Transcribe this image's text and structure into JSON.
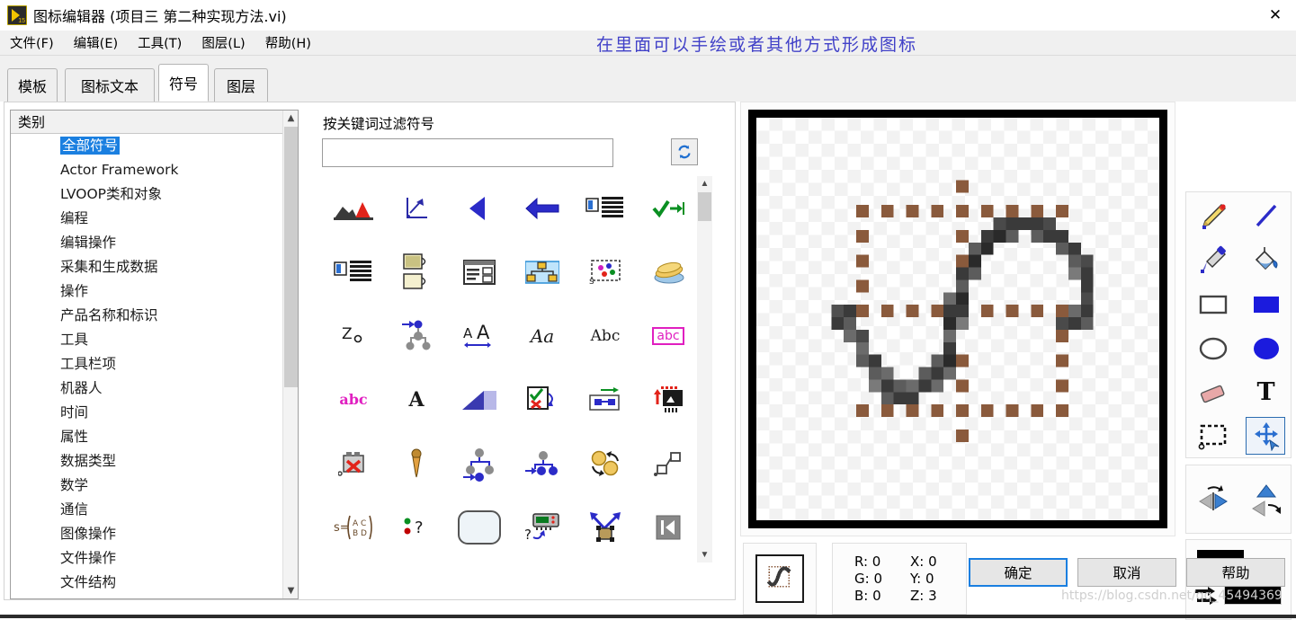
{
  "window": {
    "title": "图标编辑器 (项目三  第二种实现方法.vi)",
    "app_icon": "labview-vi-icon",
    "app_icon_version": "15",
    "close_label": "✕"
  },
  "menubar": {
    "items": [
      {
        "label": "文件(F)",
        "name": "menu-file"
      },
      {
        "label": "编辑(E)",
        "name": "menu-edit"
      },
      {
        "label": "工具(T)",
        "name": "menu-tools"
      },
      {
        "label": "图层(L)",
        "name": "menu-layers"
      },
      {
        "label": "帮助(H)",
        "name": "menu-help"
      }
    ]
  },
  "annotation": {
    "text": "在里面可以手绘或者其他方式形成图标",
    "color": "#4141c8"
  },
  "tabs": {
    "items": [
      {
        "label": "模板",
        "selected": false
      },
      {
        "label": "图标文本",
        "selected": false
      },
      {
        "label": "符号",
        "selected": true
      },
      {
        "label": "图层",
        "selected": false
      }
    ]
  },
  "category_panel": {
    "header": "类别",
    "selected": "全部符号",
    "items": [
      "全部符号",
      "Actor Framework",
      "LVOOP类和对象",
      "编程",
      "编辑操作",
      "采集和生成数据",
      "操作",
      "产品名称和标识",
      "工具",
      "工具栏项",
      "机器人",
      "时间",
      "属性",
      "数据类型",
      "数学",
      "通信",
      "图像操作",
      "文件操作",
      "文件结构"
    ]
  },
  "filter": {
    "label": "按关键词过滤符号",
    "value": "",
    "placeholder": "",
    "refresh_icon": "refresh-icon"
  },
  "symbol_grid": {
    "rows": [
      [
        "mountain-graph-icon",
        "axes-arrow-icon",
        "triangle-left-icon",
        "arrow-left-icon",
        "doc-lines-icon",
        "check-tab-icon"
      ],
      [
        "doc-lines-icon",
        "two-cups-icon",
        "table-form-icon",
        "hierarchy-icon",
        "scatter-select-icon",
        "coins-icon"
      ],
      [
        "z-sub-o-icon",
        "tree-insert-icon",
        "font-size-icon",
        "aa-font-icon",
        "abc-text-icon",
        "abc-box-icon"
      ],
      [
        "abc-magenta-icon",
        "bold-a-icon",
        "blue-wedge-icon",
        "checklist-icon",
        "link-node-icon",
        "import-sheet-icon"
      ],
      [
        "delete-camera-icon",
        "pin-icon",
        "tree-add-icon",
        "tree-arrow-icon",
        "two-coins-icon",
        "two-nodes-icon"
      ],
      [
        "matrix-icon",
        "dots-question-icon",
        "rounded-rect-icon",
        "query-device-icon",
        "split-node-icon",
        "first-frame-icon"
      ]
    ]
  },
  "canvas": {
    "drawing_name": "sine-wave-drawing",
    "selection": "dashed-selection-rectangle",
    "selection_color": "#8a5a3c",
    "stroke_color": "#4a4a4a"
  },
  "tools": {
    "main": [
      {
        "name": "pencil-tool",
        "active": false
      },
      {
        "name": "line-tool",
        "active": false
      },
      {
        "name": "eyedropper-tool",
        "active": false
      },
      {
        "name": "fill-bucket-tool",
        "active": false
      },
      {
        "name": "rectangle-outline-tool",
        "active": false
      },
      {
        "name": "rectangle-filled-tool",
        "active": false
      },
      {
        "name": "ellipse-outline-tool",
        "active": false
      },
      {
        "name": "ellipse-filled-tool",
        "active": false
      },
      {
        "name": "eraser-tool",
        "active": false
      },
      {
        "name": "text-tool",
        "active": false
      },
      {
        "name": "select-tool",
        "active": false
      },
      {
        "name": "move-tool",
        "active": true
      }
    ],
    "flip": [
      {
        "name": "flip-horizontal-tool"
      },
      {
        "name": "flip-vertical-tool"
      }
    ],
    "color": {
      "name": "foreground-background-color",
      "foreground": "#000000",
      "background": "#000000"
    }
  },
  "status": {
    "preview_name": "icon-preview",
    "rgb": [
      {
        "label": "R: 0"
      },
      {
        "label": "X: 0"
      },
      {
        "label": "G: 0"
      },
      {
        "label": "Y: 0"
      },
      {
        "label": "B: 0"
      },
      {
        "label": "Z: 3"
      }
    ]
  },
  "buttons": {
    "ok": "确定",
    "cancel": "取消",
    "help": "帮助"
  },
  "watermark": "https://blog.csdn.net/qq_45494369"
}
